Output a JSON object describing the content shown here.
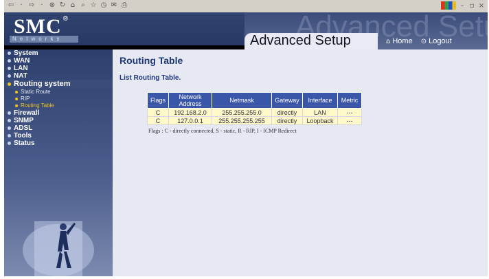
{
  "header": {
    "brand": "SMC",
    "brand_mark": "®",
    "tagline": "Networks",
    "ghost_text": "Advanced Setup",
    "title": "Advanced Setup",
    "home_label": "Home",
    "logout_label": "Logout"
  },
  "sidebar": {
    "items": [
      {
        "label": "System"
      },
      {
        "label": "WAN"
      },
      {
        "label": "LAN"
      },
      {
        "label": "NAT"
      },
      {
        "label": "Routing system"
      },
      {
        "label": "Firewall"
      },
      {
        "label": "SNMP"
      },
      {
        "label": "ADSL"
      },
      {
        "label": "Tools"
      },
      {
        "label": "Status"
      }
    ],
    "subitems": [
      {
        "label": "Static Route"
      },
      {
        "label": "RIP"
      },
      {
        "label": "Routing Table"
      }
    ]
  },
  "main": {
    "title": "Routing Table",
    "subtitle": "List Routing Table.",
    "table": {
      "headers": [
        "Flags",
        "Network Address",
        "Netmask",
        "Gateway",
        "Interface",
        "Metric"
      ],
      "rows": [
        [
          "C",
          "192.168.2.0",
          "255.255.255.0",
          "directly",
          "LAN",
          "---"
        ],
        [
          "C",
          "127.0.0.1",
          "255.255.255.255",
          "directly",
          "Loopback",
          "---"
        ]
      ]
    },
    "flags_note": "Flags :   C - directly connected, S - static, R - RIP, I - ICMP Redirect"
  },
  "colors": {
    "header_bg": "#2a3a64",
    "table_header": "#3a56a8",
    "table_cell": "#fff8c8",
    "active_sub": "#f0c420",
    "title_text": "#1f3777"
  }
}
